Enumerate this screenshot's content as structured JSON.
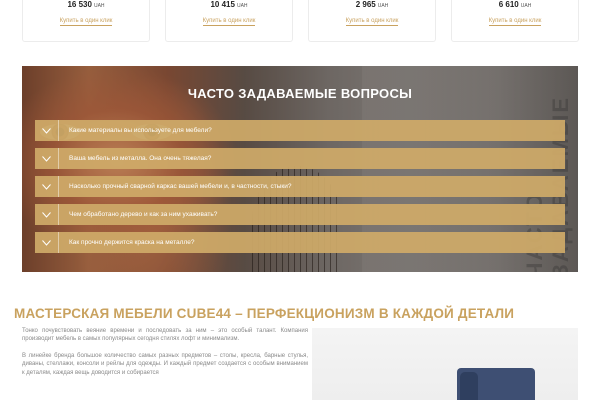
{
  "products": [
    {
      "price": "16 530",
      "currency": "UAH",
      "buy_label": "Купить в один клик"
    },
    {
      "price": "10 415",
      "currency": "UAH",
      "buy_label": "Купить в один клик"
    },
    {
      "price": "2 965",
      "currency": "UAH",
      "buy_label": "Купить в один клик"
    },
    {
      "price": "6 610",
      "currency": "UAH",
      "buy_label": "Купить в один клик"
    }
  ],
  "faq": {
    "title": "ЧАСТО ЗАДАВАЕМЫЕ ВОПРОСЫ",
    "side_text": "ЧАСТО ЗАДАВАЕМЫЕ",
    "questions": [
      "Какие материалы вы используете для мебели?",
      "Ваша мебель из металла. Она очень тяжелая?",
      "Насколько прочный сварной каркас вашей мебели и, в частности, стыки?",
      "Чем обработано дерево и как за ним ухаживать?",
      "Как прочно держится краска на металле?"
    ],
    "accent_color": "#cfaa68"
  },
  "about": {
    "title": "МАСТЕРСКАЯ МЕБЕЛИ CUBE44 – ПЕРФЕКЦИОНИЗМ В КАЖДОЙ ДЕТАЛИ",
    "paragraph_1": "Тонко почувствовать веяние времени и последовать за ним – это особый талант. Компания производит мебель в самых популярных сегодня стилях лофт и минимализм.",
    "paragraph_2": "В линейке бренда большое количество самых разных предметов – столы, кресла, барные стулья, диваны, стеллажи, консоли и рейлы для одежды. И каждый предмет создается с особым вниманием к деталям, каждая вещь доводится и собирается",
    "title_color": "#c9a25f"
  }
}
